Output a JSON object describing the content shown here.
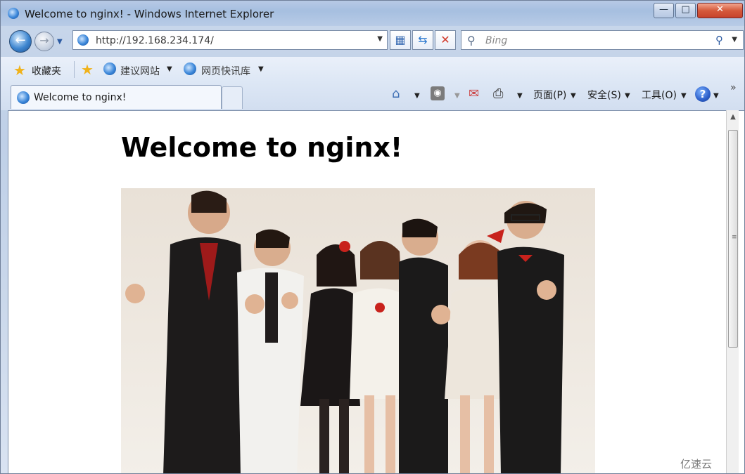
{
  "window": {
    "title": "Welcome to nginx! - Windows Internet Explorer",
    "buttons": {
      "minimize": "—",
      "maximize": "□",
      "close": "✕"
    }
  },
  "nav": {
    "address": "http://192.168.234.174/",
    "search_placeholder": "Bing"
  },
  "favorites": {
    "label": "收藏夹",
    "links": [
      "建议网站",
      "网页快讯库"
    ]
  },
  "tab": {
    "label": "Welcome to nginx!"
  },
  "command_bar": {
    "page": "页面(P)",
    "safety": "安全(S)",
    "tools": "工具(O)",
    "help": "?"
  },
  "page": {
    "heading": "Welcome to nginx!"
  },
  "watermark": "亿速云",
  "icons": {
    "app": "ie-logo-icon",
    "back": "back-arrow-icon",
    "forward": "forward-arrow-icon",
    "compat": "compatibility-view-icon",
    "refresh": "refresh-icon",
    "stop": "stop-icon",
    "search": "search-icon",
    "favorites": "favorites-star-icon",
    "home": "home-icon",
    "rss": "rss-feed-icon",
    "mail": "mail-icon",
    "print": "print-icon",
    "help": "help-icon"
  }
}
